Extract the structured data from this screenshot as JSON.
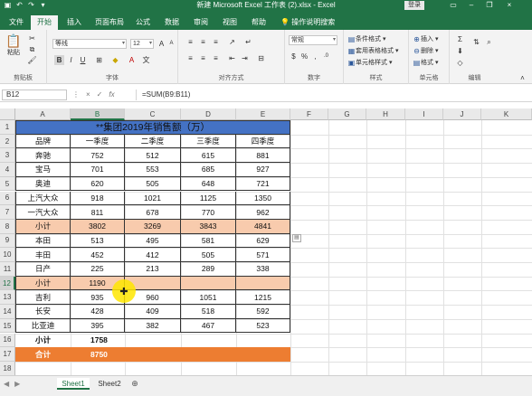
{
  "titlebar": {
    "title": "新建 Microsoft Excel 工作表 (2).xlsx  -  Excel",
    "login": "登录",
    "qat": [
      "save-icon",
      "undo-icon",
      "redo-icon",
      "customize-icon"
    ]
  },
  "tabs": [
    {
      "label": "文件"
    },
    {
      "label": "开始"
    },
    {
      "label": "插入"
    },
    {
      "label": "页面布局"
    },
    {
      "label": "公式"
    },
    {
      "label": "数据"
    },
    {
      "label": "审阅"
    },
    {
      "label": "视图"
    },
    {
      "label": "帮助"
    }
  ],
  "tellme": "操作说明搜索",
  "ribbon": {
    "clipboard": {
      "paste": "粘贴",
      "label": "剪贴板"
    },
    "font": {
      "label": "字体",
      "name": "等线",
      "size": "12"
    },
    "alignment": {
      "label": "对齐方式"
    },
    "number": {
      "label": "数字",
      "format": "常规"
    },
    "styles": {
      "label": "样式",
      "cond": "条件格式 ▾",
      "table": "套用表格格式 ▾",
      "cell": "单元格样式 ▾"
    },
    "cells": {
      "label": "单元格",
      "insert": "插入 ▾",
      "delete": "删除 ▾",
      "format": "格式 ▾"
    },
    "editing": {
      "label": "编辑"
    }
  },
  "formula_bar": {
    "namebox": "B12",
    "cancel": "×",
    "enter": "✓",
    "fx": "fx",
    "formula": "=SUM(B9:B11)"
  },
  "columns": [
    "A",
    "B",
    "C",
    "D",
    "E",
    "F",
    "G",
    "H",
    "I",
    "J",
    "K"
  ],
  "rows": [
    "1",
    "2",
    "3",
    "4",
    "5",
    "6",
    "7",
    "8",
    "9",
    "10",
    "11",
    "12",
    "13",
    "14",
    "15",
    "16",
    "17",
    "18"
  ],
  "sheet": {
    "title": "**集团2019年销售额（万）",
    "headers": [
      "品牌",
      "一季度",
      "二季度",
      "三季度",
      "四季度"
    ],
    "body": [
      [
        "奔驰",
        "752",
        "512",
        "615",
        "881"
      ],
      [
        "宝马",
        "701",
        "553",
        "685",
        "927"
      ],
      [
        "奥迪",
        "620",
        "505",
        "648",
        "721"
      ],
      [
        "上汽大众",
        "918",
        "1021",
        "1125",
        "1350"
      ],
      [
        "一汽大众",
        "811",
        "678",
        "770",
        "962"
      ],
      [
        "小计",
        "3802",
        "3269",
        "3843",
        "4841"
      ],
      [
        "本田",
        "513",
        "495",
        "581",
        "629"
      ],
      [
        "丰田",
        "452",
        "412",
        "505",
        "571"
      ],
      [
        "日产",
        "225",
        "213",
        "289",
        "338"
      ],
      [
        "小计",
        "1190",
        "",
        "",
        ""
      ],
      [
        "吉利",
        "935",
        "960",
        "1051",
        "1215"
      ],
      [
        "长安",
        "428",
        "409",
        "518",
        "592"
      ],
      [
        "比亚迪",
        "395",
        "382",
        "467",
        "523"
      ],
      [
        "小计",
        "1758",
        "",
        "",
        ""
      ],
      [
        "合计",
        "8750",
        "",
        "",
        ""
      ]
    ]
  },
  "sheets": [
    "Sheet1",
    "Sheet2"
  ],
  "colors": {
    "excel_green": "#217346",
    "title_blue": "#4472c4",
    "subtotal_peach": "#f8cbad",
    "total_orange": "#ed7d31"
  }
}
